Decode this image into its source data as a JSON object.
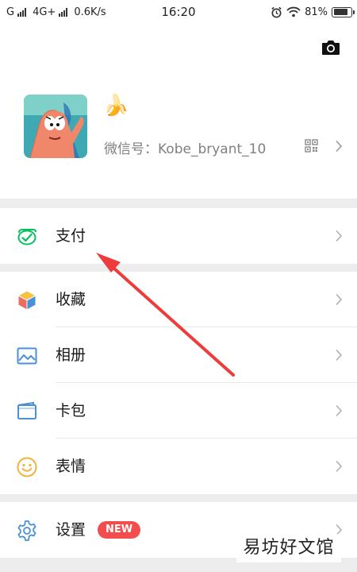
{
  "status_bar": {
    "carrier1": "G",
    "carrier2": "4G+",
    "speed": "0.6K/s",
    "time": "16:20",
    "battery": "81%",
    "battery_level": 0.81
  },
  "profile": {
    "nickname": "🍌",
    "wechat_id": "微信号：Kobe_bryant_10"
  },
  "menu": {
    "pay": "支付",
    "favorites": "收藏",
    "album": "相册",
    "cards": "卡包",
    "stickers": "表情",
    "settings": "设置",
    "settings_badge": "NEW"
  },
  "watermark": "易坊好文馆",
  "colors": {
    "accent_green": "#07c160",
    "badge_red": "#f24e4e",
    "arrow_red": "#ee3b3b",
    "icon_blue": "#4a8fd9"
  },
  "icons": {
    "camera": "camera-icon",
    "qr": "qr-code-icon",
    "pay": "wallet-check-icon",
    "favorites": "cube-icon",
    "album": "image-icon",
    "cards": "card-icon",
    "stickers": "smile-icon",
    "settings": "gear-icon"
  }
}
